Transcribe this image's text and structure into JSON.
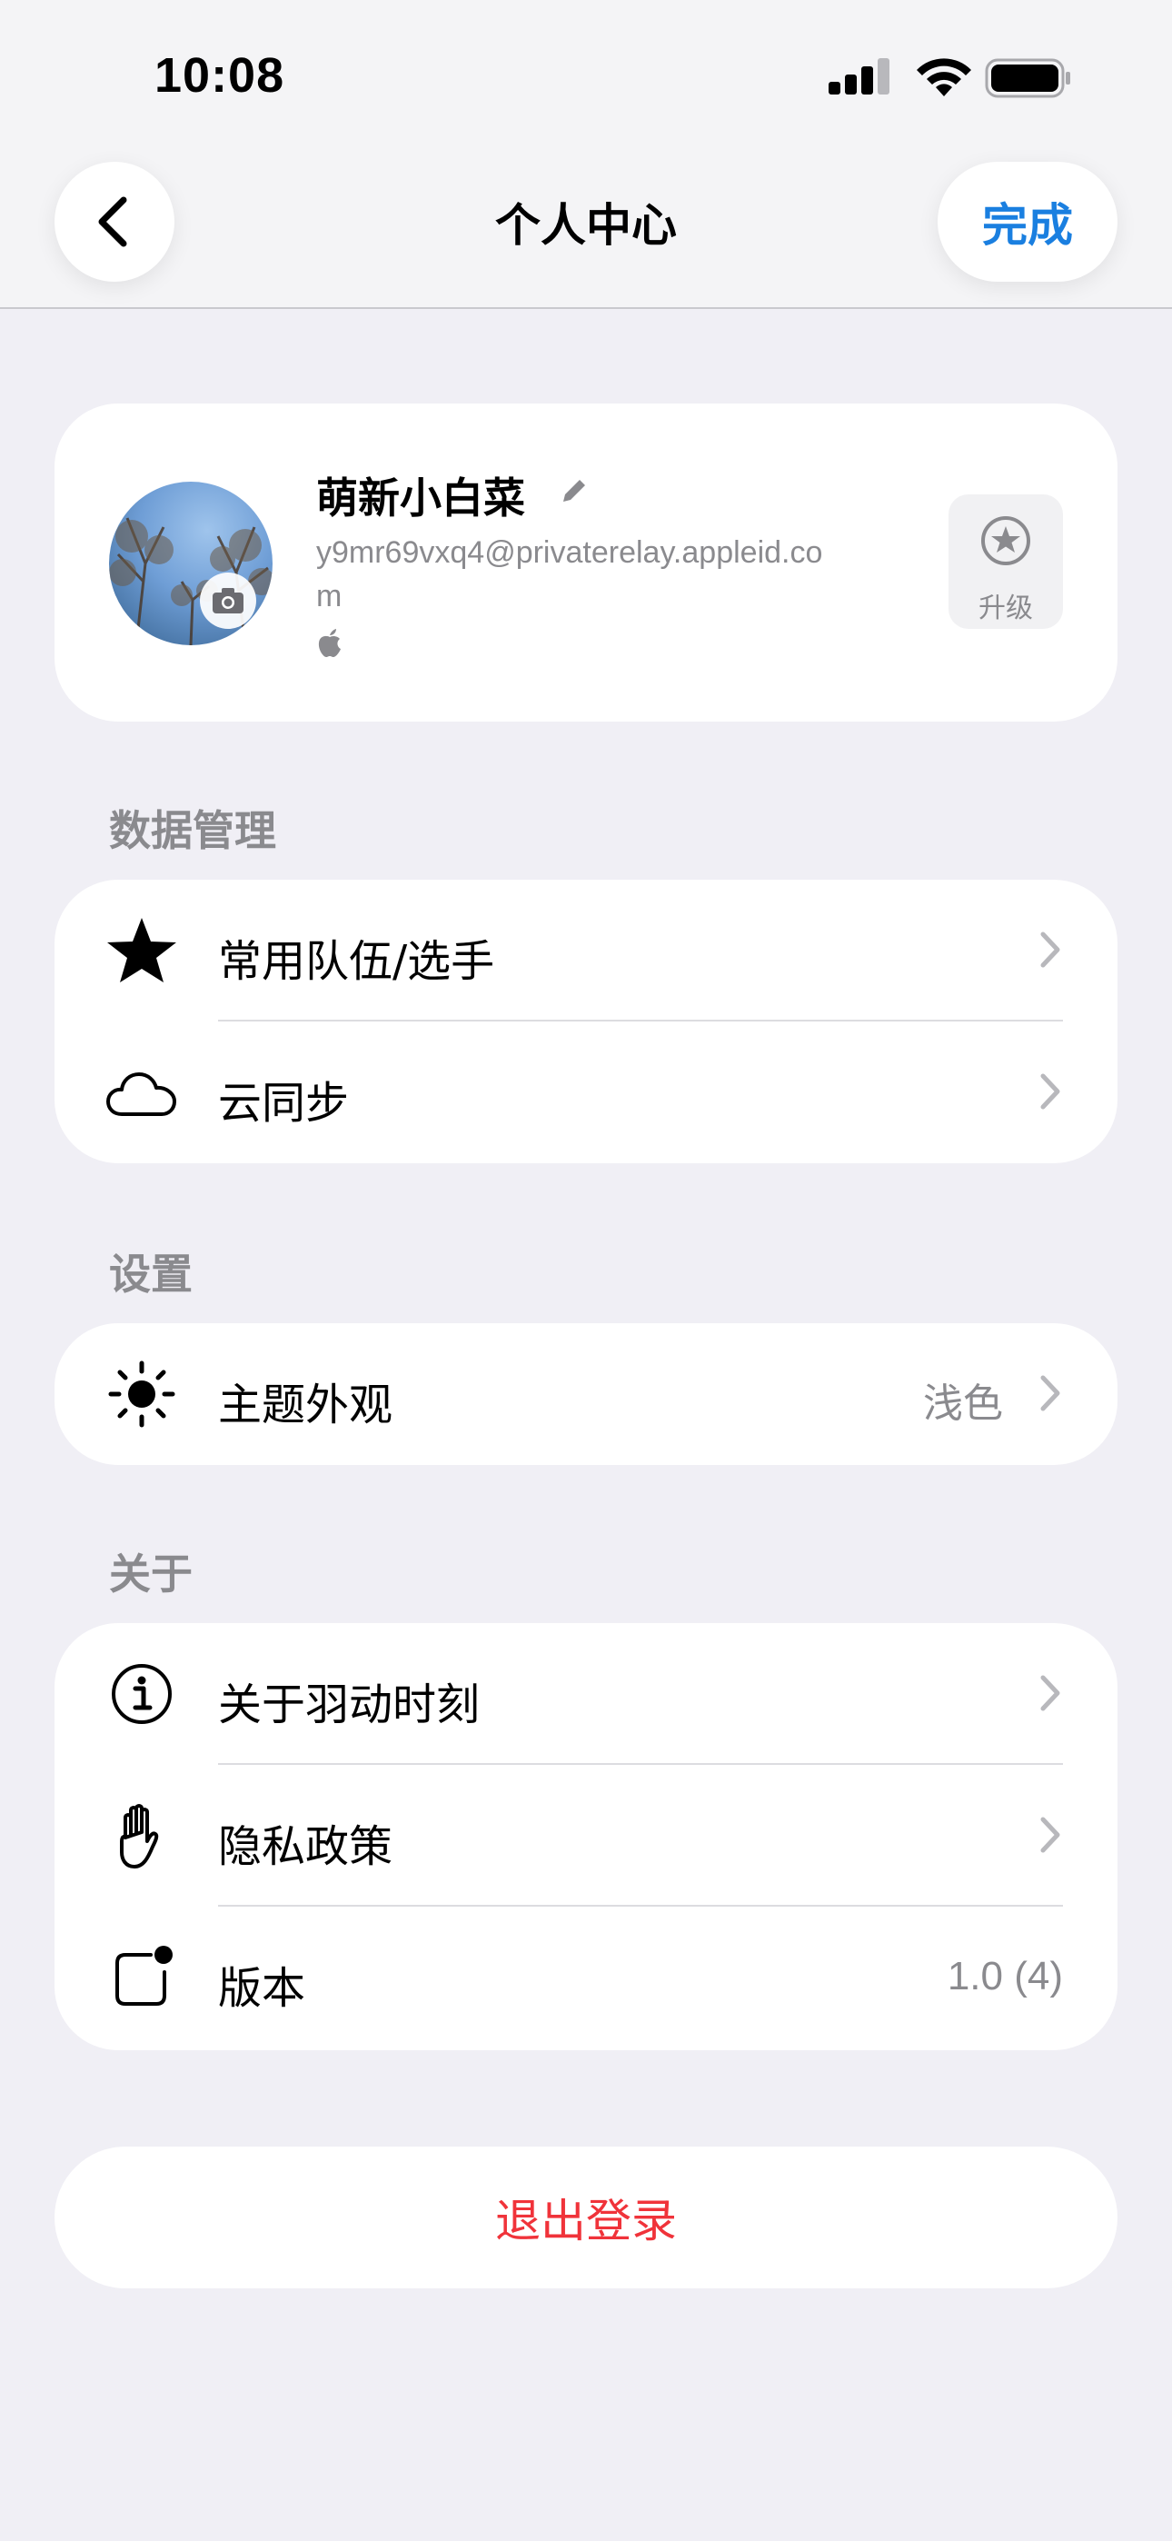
{
  "status_bar": {
    "time": "10:08"
  },
  "header": {
    "title": "个人中心",
    "done_label": "完成"
  },
  "profile": {
    "nickname": "萌新小白菜",
    "email": "y9mr69vxq4@privaterelay.appleid.com",
    "upgrade_label": "升级"
  },
  "sections": {
    "data_management": {
      "title": "数据管理",
      "items": [
        {
          "label": "常用队伍/选手",
          "icon": "star-icon"
        },
        {
          "label": "云同步",
          "icon": "cloud-icon"
        }
      ]
    },
    "settings": {
      "title": "设置",
      "items": [
        {
          "label": "主题外观",
          "value": "浅色",
          "icon": "sun-icon"
        }
      ]
    },
    "about": {
      "title": "关于",
      "items": [
        {
          "label": "关于羽动时刻",
          "icon": "info-icon"
        },
        {
          "label": "隐私政策",
          "icon": "hand-icon"
        },
        {
          "label": "版本",
          "value": "1.0 (4)",
          "icon": "version-badge-icon"
        }
      ]
    }
  },
  "logout_label": "退出登录",
  "colors": {
    "accent": "#1a7fe0",
    "danger": "#f0333a",
    "secondary_text": "#8a8a8e",
    "background": "#f0eff5"
  }
}
